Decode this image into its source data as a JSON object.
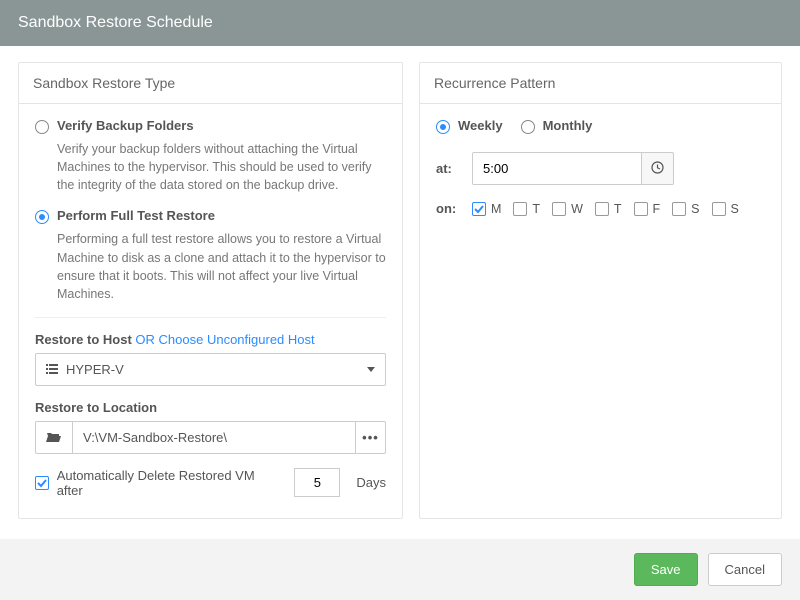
{
  "header": {
    "title": "Sandbox Restore Schedule"
  },
  "left": {
    "title": "Sandbox Restore Type",
    "verify": {
      "label": "Verify Backup Folders",
      "desc": "Verify your backup folders without attaching the Virtual Machines to the hypervisor. This should be used to verify the integrity of the data stored on the backup drive.",
      "checked": false
    },
    "full": {
      "label": "Perform Full Test Restore",
      "desc": "Performing a full test restore allows you to restore a Virtual Machine to disk as a clone and attach it to the hypervisor to ensure that it boots. This will not affect your live Virtual Machines.",
      "checked": true
    },
    "restore_host_label": "Restore to Host",
    "or_link": "OR Choose Unconfigured Host",
    "host_value": "HYPER-V",
    "restore_loc_label": "Restore to Location",
    "location_value": "V:\\VM-Sandbox-Restore\\",
    "auto_delete_label": "Automatically Delete Restored VM after",
    "auto_delete_checked": true,
    "days_value": "5",
    "days_suffix": "Days"
  },
  "right": {
    "title": "Recurrence Pattern",
    "weekly_label": "Weekly",
    "monthly_label": "Monthly",
    "weekly_checked": true,
    "at_label": "at:",
    "time_value": "5:00",
    "on_label": "on:",
    "days": [
      {
        "label": "M",
        "checked": true
      },
      {
        "label": "T",
        "checked": false
      },
      {
        "label": "W",
        "checked": false
      },
      {
        "label": "T",
        "checked": false
      },
      {
        "label": "F",
        "checked": false
      },
      {
        "label": "S",
        "checked": false
      },
      {
        "label": "S",
        "checked": false
      }
    ]
  },
  "footer": {
    "save": "Save",
    "cancel": "Cancel"
  }
}
